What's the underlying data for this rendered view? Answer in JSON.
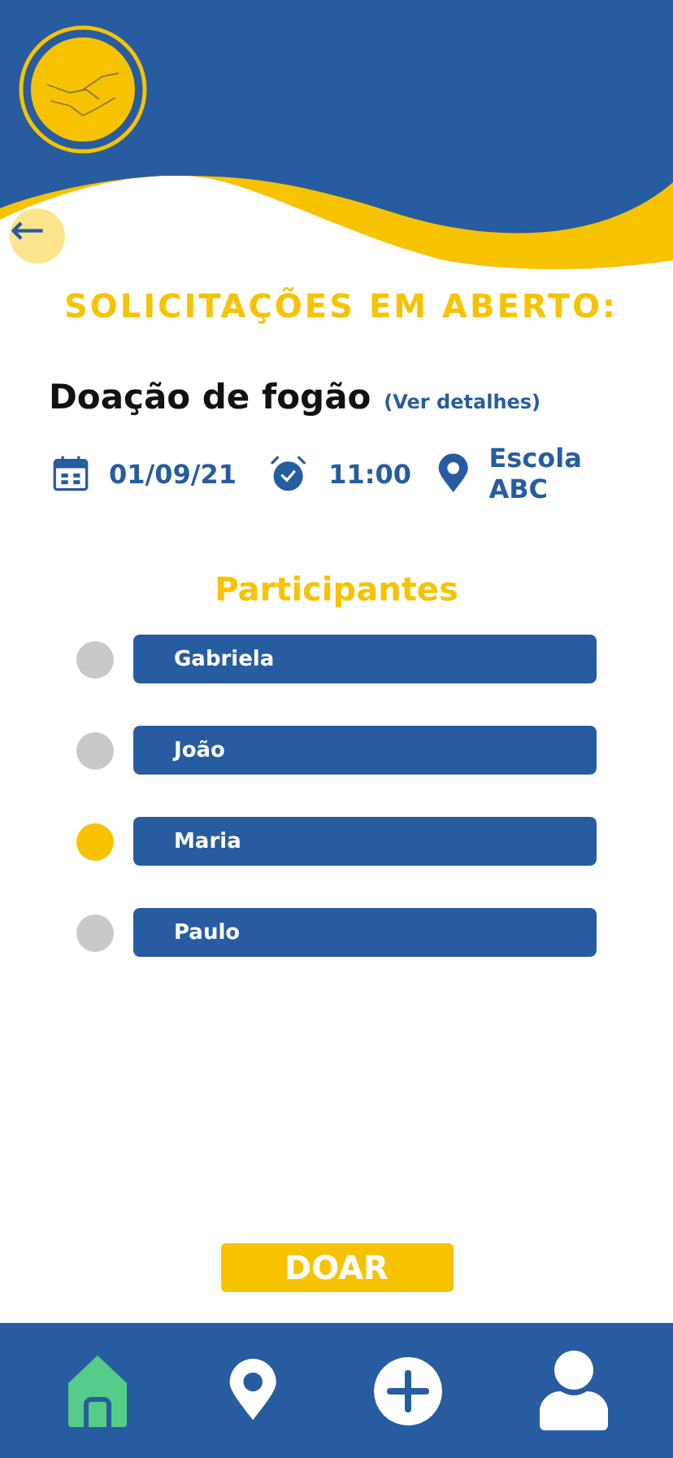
{
  "header": {
    "back_label": "←"
  },
  "title": "SOLICITAÇÕES EM ABERTO:",
  "request": {
    "name": "Doação de fogão",
    "details_link": "(Ver detalhes)",
    "date": "01/09/21",
    "time": "11:00",
    "place": "Escola ABC"
  },
  "participants_title": "Participantes",
  "participants": [
    {
      "name": "Gabriela",
      "selected": false
    },
    {
      "name": "João",
      "selected": false
    },
    {
      "name": "Maria",
      "selected": true
    },
    {
      "name": "Paulo",
      "selected": false
    }
  ],
  "donate_button": "DOAR",
  "nav": [
    {
      "kind": "home",
      "selected": true
    },
    {
      "kind": "map",
      "selected": false
    },
    {
      "kind": "add",
      "selected": false
    },
    {
      "kind": "profile",
      "selected": false
    }
  ]
}
